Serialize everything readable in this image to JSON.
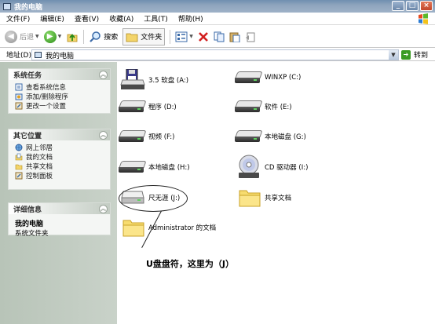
{
  "window": {
    "title": "我的电脑"
  },
  "menu": [
    "文件(F)",
    "编辑(E)",
    "查看(V)",
    "收藏(A)",
    "工具(T)",
    "帮助(H)"
  ],
  "toolbar": {
    "back": "后退",
    "search": "搜索",
    "folders": "文件夹"
  },
  "address": {
    "label": "地址(D)",
    "value": "我的电脑",
    "go": "转到"
  },
  "sidebar": {
    "system_tasks": {
      "title": "系统任务",
      "items": [
        "查看系统信息",
        "添加/删除程序",
        "更改一个设置"
      ]
    },
    "other_places": {
      "title": "其它位置",
      "items": [
        "网上邻居",
        "我的文档",
        "共享文档",
        "控制面板"
      ]
    },
    "details": {
      "title": "详细信息",
      "name": "我的电脑",
      "type": "系统文件夹"
    }
  },
  "items": [
    {
      "label": "3.5 软盘 (A:)",
      "icon": "floppy-drive-icon"
    },
    {
      "label": "WINXP (C:)",
      "icon": "hard-drive-icon"
    },
    {
      "label": "程序 (D:)",
      "icon": "hard-drive-icon"
    },
    {
      "label": "软件 (E:)",
      "icon": "hard-drive-icon"
    },
    {
      "label": "视频 (F:)",
      "icon": "hard-drive-icon"
    },
    {
      "label": "本地磁盘 (G:)",
      "icon": "hard-drive-icon"
    },
    {
      "label": "本地磁盘 (H:)",
      "icon": "hard-drive-icon"
    },
    {
      "label": "CD 驱动器 (I:)",
      "icon": "cd-drive-icon"
    },
    {
      "label": "尺无涯 (J:)",
      "icon": "usb-drive-icon"
    },
    {
      "label": "共享文档",
      "icon": "folder-icon"
    },
    {
      "label": "Administrator 的文档",
      "icon": "folder-icon"
    }
  ],
  "annotation": "U盘盘符，这里为（J）",
  "colors": {
    "titlebar": "#7f99b8",
    "sidebar": "#c0cac0",
    "go": "#3a9b24",
    "delete": "#d21f1f"
  }
}
